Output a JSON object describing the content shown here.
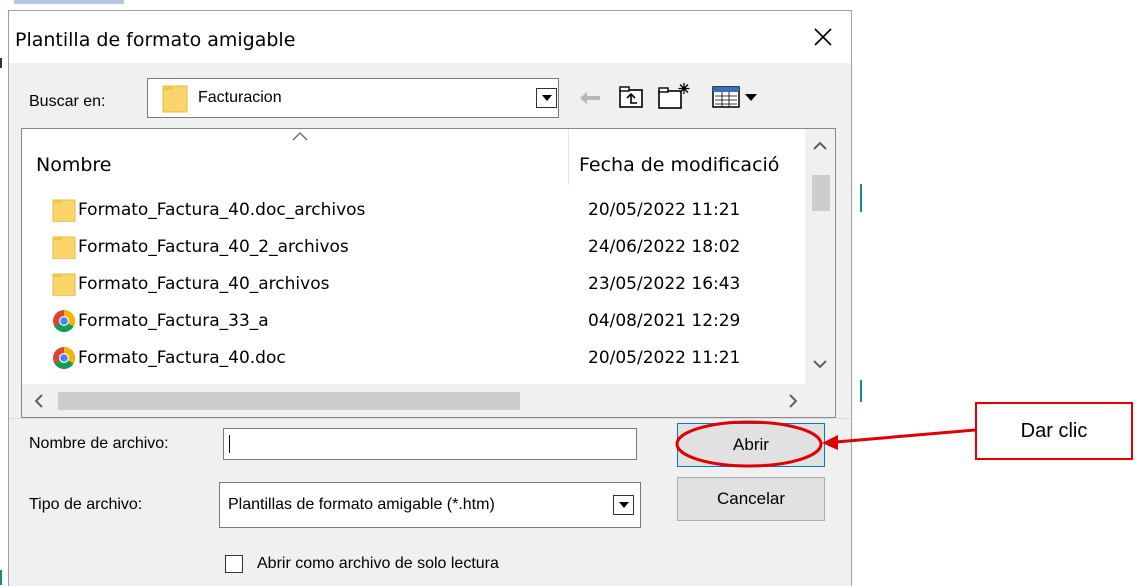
{
  "dialog": {
    "title": "Plantilla de formato amigable",
    "lookin_label": "Buscar en:",
    "lookin_value": "Facturacion"
  },
  "list": {
    "col_name": "Nombre",
    "col_date": "Fecha de modificació",
    "rows": [
      {
        "name": "Formato_Factura_40.doc_archivos",
        "date": "20/05/2022 11:21",
        "icon": "folder-icon"
      },
      {
        "name": "Formato_Factura_40_2_archivos",
        "date": "24/06/2022 18:02",
        "icon": "folder-icon"
      },
      {
        "name": "Formato_Factura_40_archivos",
        "date": "23/05/2022 16:43",
        "icon": "folder-icon"
      },
      {
        "name": "Formato_Factura_33_a",
        "date": "04/08/2021 12:29",
        "icon": "chrome-icon"
      },
      {
        "name": "Formato_Factura_40.doc",
        "date": "20/05/2022 11:21",
        "icon": "chrome-icon"
      }
    ]
  },
  "form": {
    "filename_label": "Nombre de archivo:",
    "filename_value": "",
    "filetype_label": "Tipo de archivo:",
    "filetype_value": "Plantillas de formato amigable (*.htm)",
    "readonly_label": "Abrir como archivo de solo lectura"
  },
  "buttons": {
    "open": "Abrir",
    "cancel": "Cancelar"
  },
  "annotation": {
    "callout_text": "Dar clic",
    "color": "#e00000"
  }
}
